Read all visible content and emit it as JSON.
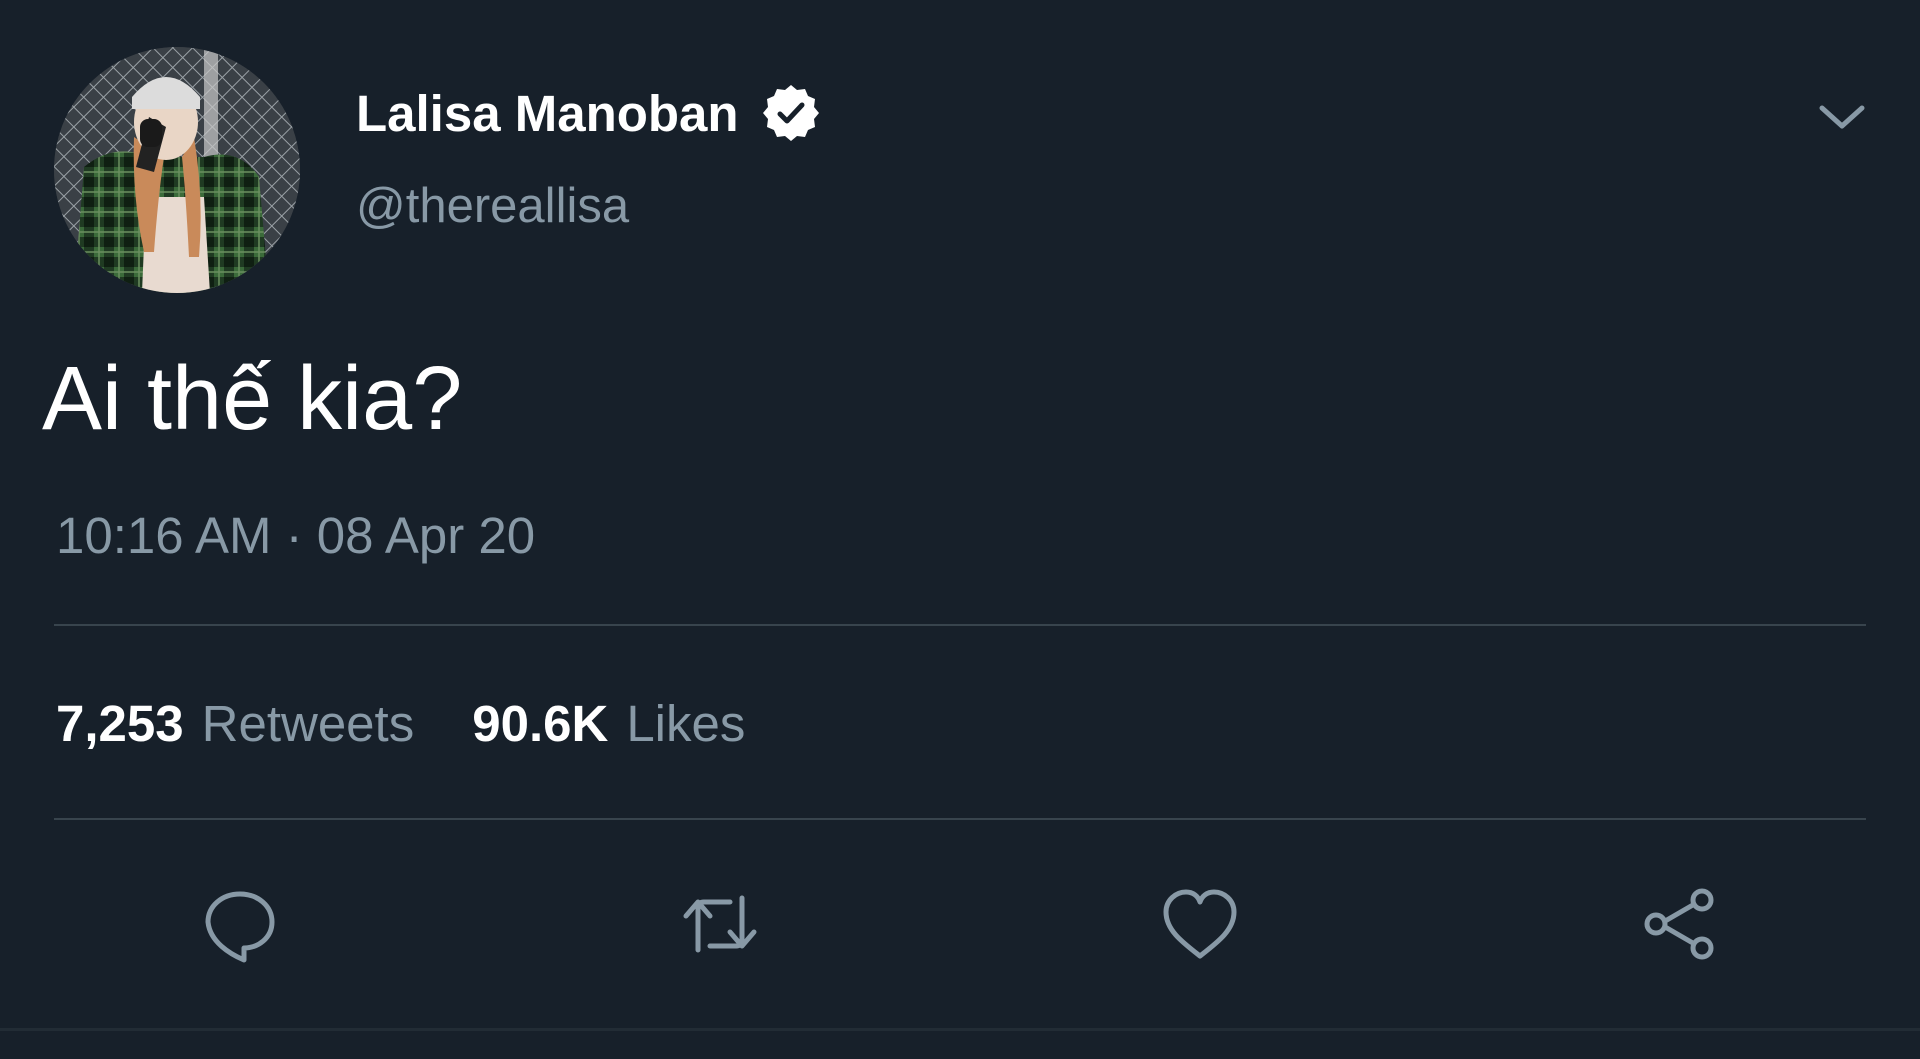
{
  "tweet": {
    "display_name": "Lalisa Manoban",
    "handle": "@thereallisa",
    "text": "Ai thế kia?",
    "timestamp": "10:16 AM · 08 Apr 20",
    "stats": {
      "retweets_count": "7,253",
      "retweets_label": "Retweets",
      "likes_count": "90.6K",
      "likes_label": "Likes"
    }
  },
  "icons": {
    "verified": "verified-badge-icon",
    "menu": "chevron-down-icon",
    "reply": "reply-icon",
    "retweet": "retweet-icon",
    "like": "heart-icon",
    "share": "share-icon"
  },
  "colors": {
    "background": "#17202a",
    "primary_text": "#ffffff",
    "secondary_text": "#8899a6",
    "divider": "#38444d"
  }
}
